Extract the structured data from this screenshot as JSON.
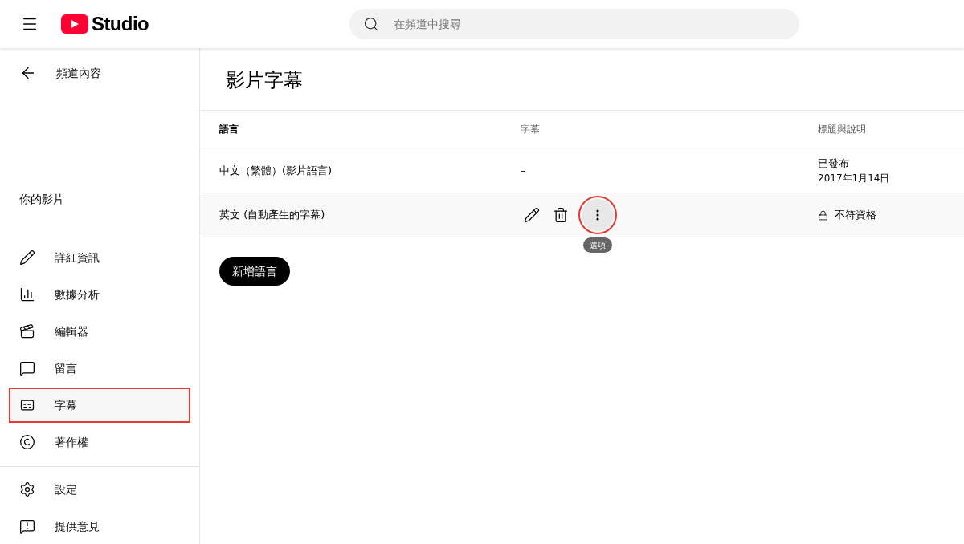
{
  "header": {
    "logo_text": "Studio",
    "search": {
      "placeholder": "在頻道中搜尋"
    }
  },
  "sidebar": {
    "back_label": "頻道內容",
    "section_title": "你的影片",
    "items": [
      {
        "label": "詳細資訊",
        "kind": "pencil",
        "selected": false
      },
      {
        "label": "數據分析",
        "kind": "chart",
        "selected": false
      },
      {
        "label": "編輯器",
        "kind": "clapper",
        "selected": false
      },
      {
        "label": "留言",
        "kind": "comment",
        "selected": false
      },
      {
        "label": "字幕",
        "kind": "subtitles",
        "selected": true
      },
      {
        "label": "著作權",
        "kind": "copyright",
        "selected": false
      }
    ],
    "footer_items": [
      {
        "label": "設定",
        "kind": "gear"
      },
      {
        "label": "提供意見",
        "kind": "feedback"
      }
    ]
  },
  "page_title": "影片字幕",
  "table": {
    "columns": [
      "語言",
      "字幕",
      "標題與說明"
    ],
    "rows": [
      {
        "kind": "published",
        "language": "中文（繁體）(影片語言)",
        "subtitles": "–",
        "status": "已發布",
        "date": "2017年1月14日"
      },
      {
        "kind": "actions",
        "language": "英文 (自動產生的字幕)",
        "status": "不符資格",
        "options_highlighted": true,
        "tooltip": "選項"
      }
    ]
  },
  "add_button": "新增語言"
}
